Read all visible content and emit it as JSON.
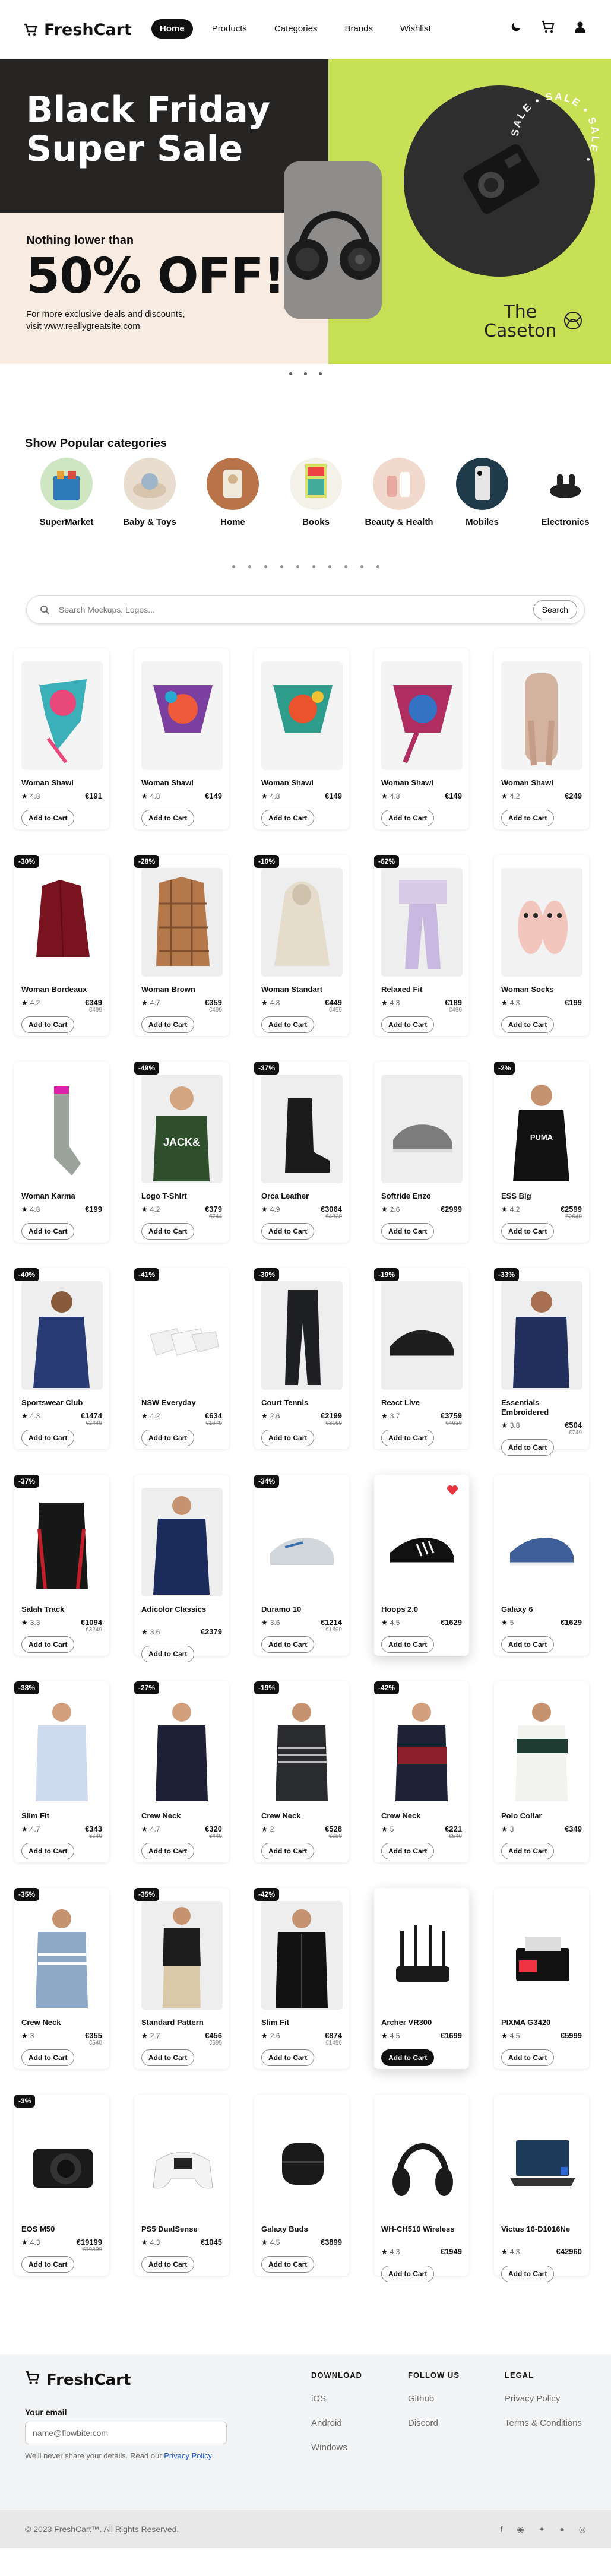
{
  "header": {
    "brand": "FreshCart",
    "nav": [
      "Home",
      "Products",
      "Categories",
      "Brands",
      "Wishlist"
    ]
  },
  "hero": {
    "title1": "Black Friday",
    "title2": "Super Sale",
    "tagline": "Nothing lower than",
    "discount": "50% OFF!",
    "desc1": "For more exclusive deals and discounts,",
    "desc2": "visit www.reallygreatsite.com",
    "ring": "SALE • SALE • SALE •",
    "brand1": "The",
    "brand2": "Caseton"
  },
  "categories": {
    "title": "Show Popular categories",
    "items": [
      "SuperMarket",
      "Baby & Toys",
      "Home",
      "Books",
      "Beauty & Health",
      "Mobiles",
      "Electronics"
    ]
  },
  "search": {
    "placeholder": "Search Mockups, Logos...",
    "button": "Search"
  },
  "add_to_cart": "Add to Cart",
  "products": [
    {
      "name": "Woman Shawl",
      "rating": "4.8",
      "price": "€191",
      "old": "",
      "badge": "",
      "img": "scarf1"
    },
    {
      "name": "Woman Shawl",
      "rating": "4.8",
      "price": "€149",
      "old": "",
      "badge": "",
      "img": "scarf2"
    },
    {
      "name": "Woman Shawl",
      "rating": "4.8",
      "price": "€149",
      "old": "",
      "badge": "",
      "img": "scarf3"
    },
    {
      "name": "Woman Shawl",
      "rating": "4.8",
      "price": "€149",
      "old": "",
      "badge": "",
      "img": "scarf4"
    },
    {
      "name": "Woman Shawl",
      "rating": "4.2",
      "price": "€249",
      "old": "",
      "badge": "",
      "img": "scarf5"
    },
    {
      "name": "Woman Bordeaux",
      "rating": "4.2",
      "price": "€349",
      "old": "€499",
      "badge": "-30%",
      "img": "shirt-red"
    },
    {
      "name": "Woman Brown",
      "rating": "4.7",
      "price": "€359",
      "old": "€499",
      "badge": "-28%",
      "img": "shirt-plaid"
    },
    {
      "name": "Woman Standart",
      "rating": "4.8",
      "price": "€449",
      "old": "€499",
      "badge": "-10%",
      "img": "hoodie-cream"
    },
    {
      "name": "Relaxed Fit",
      "rating": "4.8",
      "price": "€189",
      "old": "€499",
      "badge": "-62%",
      "img": "pants-lilac"
    },
    {
      "name": "Woman Socks",
      "rating": "4.3",
      "price": "€199",
      "old": "",
      "badge": "",
      "img": "slippers"
    },
    {
      "name": "Woman Karma",
      "rating": "4.8",
      "price": "€199",
      "old": "",
      "badge": "",
      "img": "socks"
    },
    {
      "name": "Logo T-Shirt",
      "rating": "4.2",
      "price": "€379",
      "old": "€744",
      "badge": "-49%",
      "img": "tshirt-green"
    },
    {
      "name": "Orca Leather",
      "rating": "4.9",
      "price": "€3064",
      "old": "€4820",
      "badge": "-37%",
      "img": "boot"
    },
    {
      "name": "Softride Enzo",
      "rating": "2.6",
      "price": "€2999",
      "old": "",
      "badge": "",
      "img": "shoe-grey"
    },
    {
      "name": "ESS Big",
      "rating": "4.2",
      "price": "€2599",
      "old": "€2640",
      "badge": "-2%",
      "img": "hoodie-black"
    },
    {
      "name": "Sportswear Club",
      "rating": "4.3",
      "price": "€1474",
      "old": "€2449",
      "badge": "-40%",
      "img": "hoodie-blue"
    },
    {
      "name": "NSW Everyday",
      "rating": "4.2",
      "price": "€634",
      "old": "€1079",
      "badge": "-41%",
      "img": "socks-white"
    },
    {
      "name": "Court Tennis",
      "rating": "2.6",
      "price": "€2199",
      "old": "€3169",
      "badge": "-30%",
      "img": "joggers"
    },
    {
      "name": "React Live",
      "rating": "3.7",
      "price": "€3759",
      "old": "€4639",
      "badge": "-19%",
      "img": "shoe-black"
    },
    {
      "name": "Essentials Embroidered",
      "rating": "3.8",
      "price": "€504",
      "old": "€749",
      "badge": "-33%",
      "img": "tshirt-navy"
    },
    {
      "name": "Salah Track",
      "rating": "3.3",
      "price": "€1094",
      "old": "€3249",
      "badge": "-37%",
      "img": "track-jacket"
    },
    {
      "name": "Adicolor Classics",
      "rating": "3.6",
      "price": "€2379",
      "old": "",
      "badge": "",
      "img": "jacket-navy"
    },
    {
      "name": "Duramo 10",
      "rating": "3.6",
      "price": "€1214",
      "old": "€1899",
      "badge": "-34%",
      "img": "shoe-white"
    },
    {
      "name": "Hoops 2.0",
      "rating": "4.5",
      "price": "€1629",
      "old": "",
      "badge": "",
      "img": "shoe-bw"
    },
    {
      "name": "Galaxy 6",
      "rating": "5",
      "price": "€1629",
      "old": "",
      "badge": "",
      "img": "shoe-blue"
    },
    {
      "name": "Slim Fit",
      "rating": "4.7",
      "price": "€343",
      "old": "€640",
      "badge": "-38%",
      "img": "shirt-lblue"
    },
    {
      "name": "Crew Neck",
      "rating": "4.7",
      "price": "€320",
      "old": "€440",
      "badge": "-27%",
      "img": "sweater-navy"
    },
    {
      "name": "Crew Neck",
      "rating": "2",
      "price": "€528",
      "old": "€650",
      "badge": "-19%",
      "img": "sweater-stripe"
    },
    {
      "name": "Crew Neck",
      "rating": "5",
      "price": "€221",
      "old": "€540",
      "badge": "-42%",
      "img": "sweater-red"
    },
    {
      "name": "Polo Collar",
      "rating": "3",
      "price": "€349",
      "old": "",
      "badge": "",
      "img": "polo"
    },
    {
      "name": "Crew Neck",
      "rating": "3",
      "price": "€355",
      "old": "€540",
      "badge": "-35%",
      "img": "sweater-lblue"
    },
    {
      "name": "Standard Pattern",
      "rating": "2.7",
      "price": "€456",
      "old": "€699",
      "badge": "-35%",
      "img": "standard"
    },
    {
      "name": "Slim Fit",
      "rating": "2.6",
      "price": "€874",
      "old": "€1499",
      "badge": "-42%",
      "img": "leather-jacket"
    },
    {
      "name": "Archer VR300",
      "rating": "4.5",
      "price": "€1699",
      "old": "",
      "badge": "",
      "img": "router"
    },
    {
      "name": "PIXMA G3420",
      "rating": "4.5",
      "price": "€5999",
      "old": "",
      "badge": "",
      "img": "printer"
    },
    {
      "name": "EOS M50",
      "rating": "4.3",
      "price": "€19199",
      "old": "€19809",
      "badge": "-3%",
      "img": "camera"
    },
    {
      "name": "PS5 DualSense",
      "rating": "4.3",
      "price": "€1045",
      "old": "",
      "badge": "",
      "img": "controller"
    },
    {
      "name": "Galaxy Buds",
      "rating": "4.5",
      "price": "€3899",
      "old": "",
      "badge": "",
      "img": "buds"
    },
    {
      "name": "WH-CH510 Wireless",
      "rating": "4.3",
      "price": "€1949",
      "old": "",
      "badge": "",
      "img": "headphones"
    },
    {
      "name": "Victus 16-D1016Ne",
      "rating": "4.3",
      "price": "€42960",
      "old": "",
      "badge": "",
      "img": "laptop"
    }
  ],
  "footer": {
    "brand": "FreshCart",
    "email_label": "Your email",
    "email_placeholder": "name@flowbite.com",
    "note": "We'll never share your details. Read our",
    "note_link": "Privacy Policy",
    "col1_title": "DOWNLOAD",
    "col1": [
      "iOS",
      "Android",
      "Windows"
    ],
    "col2_title": "FOLLOW US",
    "col2": [
      "Github",
      "Discord"
    ],
    "col3_title": "LEGAL",
    "col3": [
      "Privacy Policy",
      "Terms & Conditions"
    ],
    "copyright": "© 2023 FreshCart™. All Rights Reserved."
  }
}
